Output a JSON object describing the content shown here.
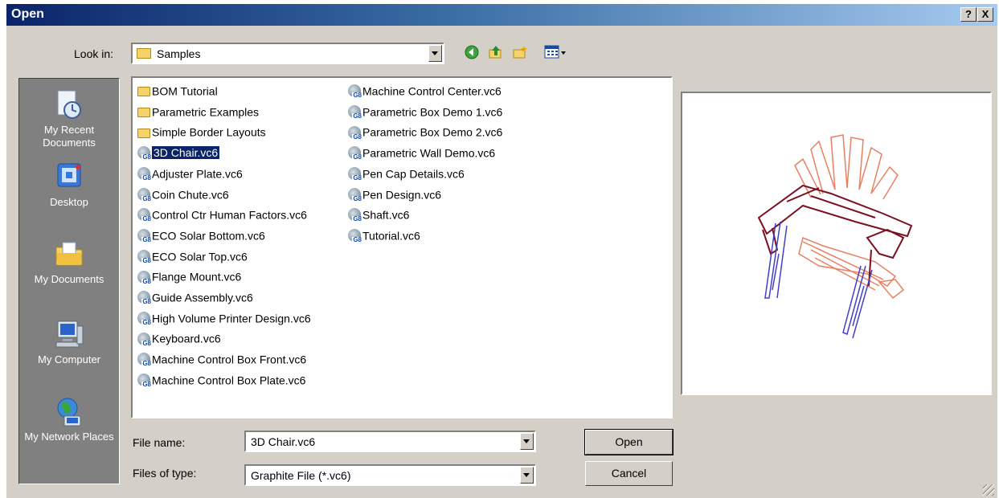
{
  "window": {
    "title": "Open",
    "help_label": "?",
    "close_label": "X"
  },
  "look_in": {
    "label": "Look in:",
    "value": "Samples"
  },
  "toolbar": {
    "icons": [
      "back-icon",
      "up-folder-icon",
      "new-folder-icon",
      "view-menu-icon"
    ]
  },
  "places": [
    {
      "label": "My Recent Documents",
      "icon": "recent-documents-icon"
    },
    {
      "label": "Desktop",
      "icon": "desktop-icon"
    },
    {
      "label": "My Documents",
      "icon": "my-documents-icon"
    },
    {
      "label": "My Computer",
      "icon": "my-computer-icon"
    },
    {
      "label": "My Network Places",
      "icon": "network-places-icon"
    }
  ],
  "files": {
    "column1": [
      {
        "name": "BOM Tutorial",
        "type": "folder"
      },
      {
        "name": "Parametric Examples",
        "type": "folder"
      },
      {
        "name": "Simple Border Layouts",
        "type": "folder"
      },
      {
        "name": "3D Chair.vc6",
        "type": "file",
        "selected": true
      },
      {
        "name": "Adjuster Plate.vc6",
        "type": "file"
      },
      {
        "name": "Coin Chute.vc6",
        "type": "file"
      },
      {
        "name": "Control Ctr Human Factors.vc6",
        "type": "file"
      },
      {
        "name": "ECO Solar Bottom.vc6",
        "type": "file"
      },
      {
        "name": "ECO Solar Top.vc6",
        "type": "file"
      },
      {
        "name": "Flange Mount.vc6",
        "type": "file"
      },
      {
        "name": "Guide Assembly.vc6",
        "type": "file"
      },
      {
        "name": "High Volume Printer Design.vc6",
        "type": "file"
      },
      {
        "name": "Keyboard.vc6",
        "type": "file"
      },
      {
        "name": "Machine Control Box Front.vc6",
        "type": "file"
      },
      {
        "name": "Machine Control Box Plate.vc6",
        "type": "file"
      }
    ],
    "column2": [
      {
        "name": "Machine Control Center.vc6",
        "type": "file"
      },
      {
        "name": "Parametric Box Demo 1.vc6",
        "type": "file"
      },
      {
        "name": "Parametric Box Demo 2.vc6",
        "type": "file"
      },
      {
        "name": "Parametric Wall Demo.vc6",
        "type": "file"
      },
      {
        "name": "Pen Cap Details.vc6",
        "type": "file"
      },
      {
        "name": "Pen Design.vc6",
        "type": "file"
      },
      {
        "name": "Shaft.vc6",
        "type": "file"
      },
      {
        "name": "Tutorial.vc6",
        "type": "file"
      }
    ]
  },
  "file_name": {
    "label": "File name:",
    "value": "3D Chair.vc6"
  },
  "file_type": {
    "label": "Files of type:",
    "value": "Graphite File (*.vc6)"
  },
  "buttons": {
    "open": "Open",
    "cancel": "Cancel"
  },
  "colors": {
    "title_start": "#0a246a",
    "title_end": "#a6caf0",
    "dialog_bg": "#d4d0c8",
    "selection": "#0a246a"
  }
}
